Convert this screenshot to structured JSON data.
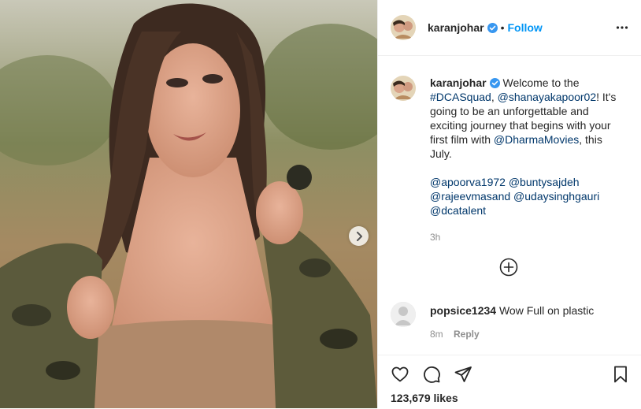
{
  "post": {
    "author": "karanjohar",
    "follow_label": "Follow",
    "header_separator": "•",
    "caption_parts": {
      "p1": "Welcome to the ",
      "tag1": "#DCASquad",
      "p2": ", ",
      "mention1": "@shanayakapoor02",
      "p3": "! It's going to be an unforgettable and exciting journey that begins with your first film with ",
      "mention2": "@DharmaMovies",
      "p4": ", this July.",
      "mention3": "@apoorva1972",
      "mention4": "@buntysajdeh",
      "mention5": "@rajeevmasand",
      "mention6": "@udaysinghgauri",
      "mention7": "@dcatalent"
    },
    "caption_time": "3h",
    "likes": "123,679 likes"
  },
  "comment": {
    "username": "popsice1234",
    "text": "Wow Full on plastic",
    "time": "8m",
    "reply_label": "Reply"
  },
  "icons": {
    "verified": "verified-badge-icon",
    "more": "more-options-icon",
    "next": "chevron-right-icon",
    "load_more": "plus-circle-icon",
    "like": "heart-icon",
    "comment": "comment-icon",
    "share": "paper-plane-icon",
    "save": "bookmark-icon"
  },
  "colors": {
    "link": "#00376b",
    "follow": "#0095f6",
    "verified": "#3897f0",
    "muted": "#8e8e8e"
  }
}
